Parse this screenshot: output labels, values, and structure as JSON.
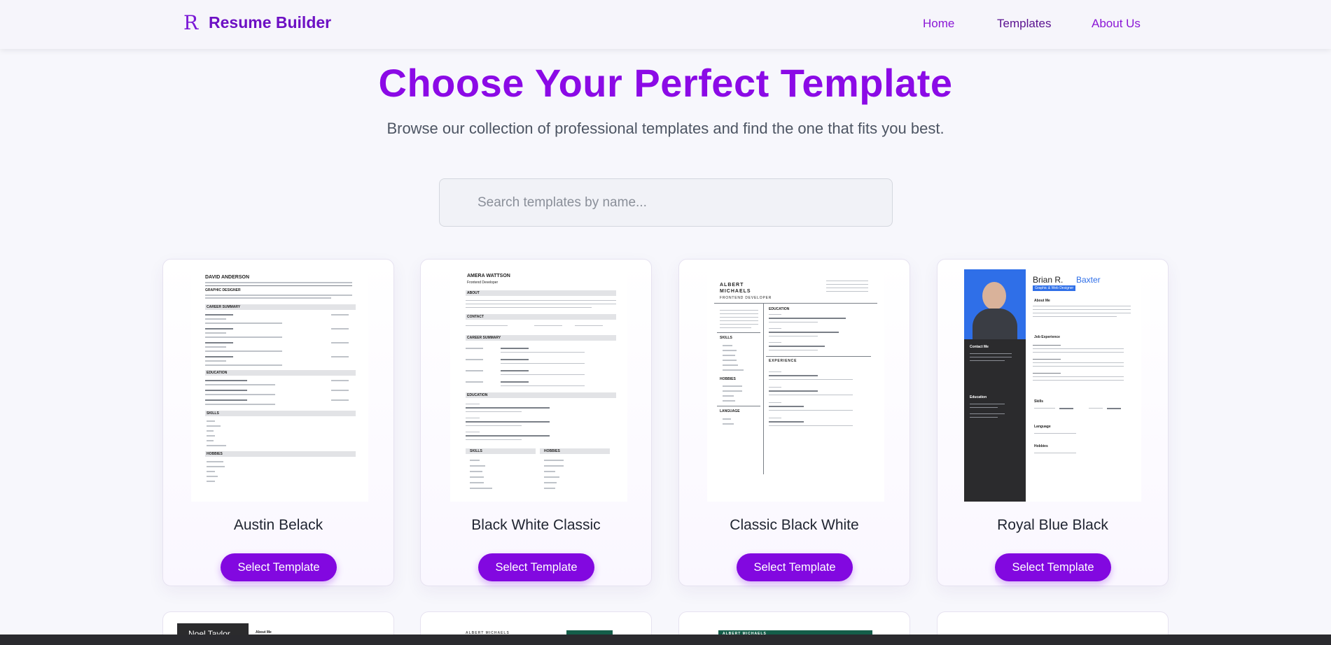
{
  "nav": {
    "brand_logo": "R",
    "brand_name": "Resume Builder",
    "links": [
      "Home",
      "Templates",
      "About Us"
    ]
  },
  "hero": {
    "title": "Choose Your Perfect Template",
    "subtitle": "Browse our collection of professional templates and find the one that fits you best."
  },
  "search": {
    "placeholder": "Search templates by name..."
  },
  "templates": [
    {
      "name": "Austin Belack",
      "button": "Select Template",
      "preview_name": "DAVID ANDERSON",
      "preview_role": "GRAPHIC DESIGNER",
      "sections": [
        "CAREER SUMMARY",
        "EDUCATION",
        "SKILLS",
        "HOBBIES"
      ]
    },
    {
      "name": "Black White Classic",
      "button": "Select Template",
      "preview_name": "AMERA WATTSON",
      "preview_role": "Frontend Developer",
      "sections": [
        "ABOUT",
        "CONTACT",
        "CAREER SUMMARY",
        "EDUCATION",
        "SKILLS",
        "HOBBIES"
      ]
    },
    {
      "name": "Classic Black White",
      "button": "Select Template",
      "preview_name": "ALBERT MICHAELS",
      "preview_role": "FRONTEND DEVELOPER",
      "sections": [
        "EDUCATION",
        "SKILLS",
        "EXPERIENCE",
        "HOBBIES",
        "LANGUAGE"
      ]
    },
    {
      "name": "Royal Blue Black",
      "button": "Select Template",
      "preview_name": "Brian R.",
      "preview_name2": "Baxter",
      "preview_role": "Graphic & Web Designer",
      "sections": [
        "About Me",
        "Contact Me",
        "Job Experience",
        "Education",
        "Skills",
        "Language",
        "Hobbies"
      ]
    }
  ],
  "next_row": [
    {
      "preview_name": "Noel Taylor",
      "preview_section": "About Me"
    },
    {
      "preview_name": "ALBERT MICHAELS"
    },
    {
      "preview_name": "ALBERT MICHAELS"
    },
    {
      "preview_name": ""
    }
  ],
  "colors": {
    "brand": "#6d10c4",
    "accent": "#8208e0",
    "title": "#8b0ae6",
    "royal_blue": "#2f6fe8"
  }
}
